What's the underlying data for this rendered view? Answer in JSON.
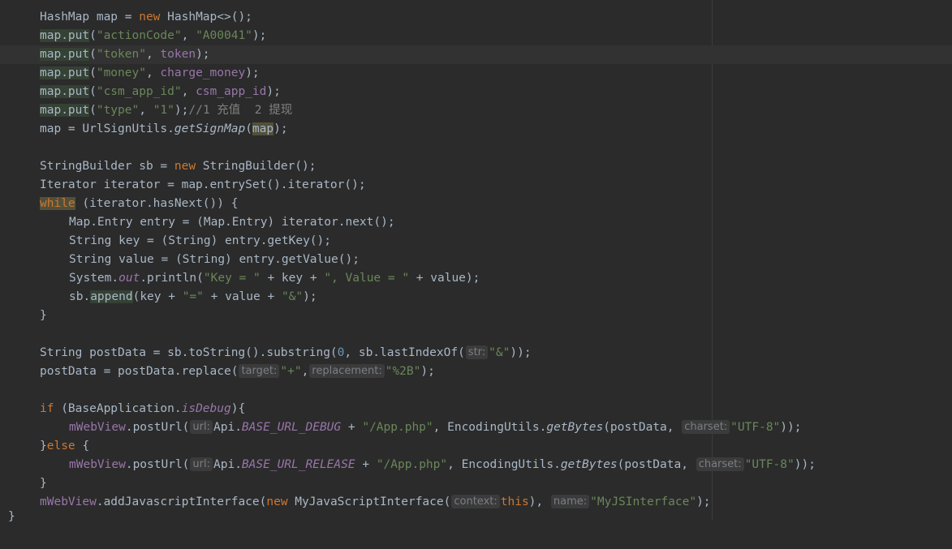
{
  "editor": {
    "lines": {
      "l1": {
        "a": "HashMap map = ",
        "b": "new",
        "c": " HashMap<>();"
      },
      "l2": {
        "a": "map.put",
        "b": "(",
        "c": "\"actionCode\"",
        "d": ", ",
        "e": "\"A00041\"",
        "f": ");"
      },
      "l3": {
        "a": "map.put",
        "b": "(",
        "c": "\"token\"",
        "d": ", ",
        "e": "token",
        "f": ");"
      },
      "l4": {
        "a": "map.put",
        "b": "(",
        "c": "\"money\"",
        "d": ", ",
        "e": "charge_money",
        "f": ");"
      },
      "l5": {
        "a": "map.put",
        "b": "(",
        "c": "\"csm_app_id\"",
        "d": ", ",
        "e": "csm_app_id",
        "f": ");"
      },
      "l6": {
        "a": "map.put",
        "b": "(",
        "c": "\"type\"",
        "d": ", ",
        "e": "\"1\"",
        "f": ");",
        "g": "//1 充值  2 提现"
      },
      "l7": {
        "a": "map = UrlSignUtils.",
        "b": "getSignMap",
        "c": "(",
        "d": "map",
        "e": ");"
      },
      "l9": {
        "a": "StringBuilder sb = ",
        "b": "new",
        "c": " StringBuilder();"
      },
      "l10": {
        "a": "Iterator iterator = map.entrySet().iterator();"
      },
      "l11": {
        "a": "while",
        "b": " (iterator.hasNext()) {"
      },
      "l12": {
        "a": "Map.Entry entry = (Map.Entry) iterator.next();"
      },
      "l13": {
        "a": "String key = (String) entry.getKey();"
      },
      "l14": {
        "a": "String value = (String) entry.getValue();"
      },
      "l15": {
        "a": "System.",
        "b": "out",
        "c": ".println(",
        "d": "\"Key = \"",
        "e": " + key + ",
        "f": "\", Value = \"",
        "g": " + value);"
      },
      "l16": {
        "a": "sb.",
        "b": "append",
        "c": "(key + ",
        "d": "\"=\"",
        "e": " + value + ",
        "f": "\"&\"",
        "g": ");"
      },
      "l17": {
        "a": "}"
      },
      "l19": {
        "a": "String postData = sb.toString().substring(",
        "b": "0",
        "c": ", sb.lastIndexOf(",
        "hint": "str:",
        "d": "\"&\"",
        "e": "));"
      },
      "l20": {
        "a": "postData = postData.replace(",
        "hint1": "target:",
        "b": "\"+\"",
        "c": ",",
        "hint2": "replacement:",
        "d": "\"%2B\"",
        "e": ");"
      },
      "l22": {
        "a": "if",
        "b": " (BaseApplication.",
        "c": "isDebug",
        "d": "){"
      },
      "l23": {
        "a": "mWebView",
        "b": ".postUrl(",
        "hint1": "url:",
        "c": "Api.",
        "d": "BASE_URL_DEBUG",
        "e": " + ",
        "f": "\"/App.php\"",
        "g": ", EncodingUtils.",
        "h": "getBytes",
        "i": "(postData, ",
        "hint2": "charset:",
        "j": "\"UTF-8\"",
        "k": "));"
      },
      "l24": {
        "a": "}",
        "b": "else",
        "c": " {"
      },
      "l25": {
        "a": "mWebView",
        "b": ".postUrl(",
        "hint1": "url:",
        "c": "Api.",
        "d": "BASE_URL_RELEASE",
        "e": " + ",
        "f": "\"/App.php\"",
        "g": ", EncodingUtils.",
        "h": "getBytes",
        "i": "(postData, ",
        "hint2": "charset:",
        "j": "\"UTF-8\"",
        "k": "));"
      },
      "l26": {
        "a": "}"
      },
      "l27": {
        "a": "mWebView",
        "b": ".addJavascriptInterface(",
        "c": "new",
        "d": " MyJavaScriptInterface(",
        "hint1": "context:",
        "e": "this",
        "f": "), ",
        "hint2": "name:",
        "g": "\"MyJSInterface\"",
        "h": ");"
      },
      "l28": {
        "a": "}"
      }
    }
  },
  "colors": {
    "background": "#2b2b2b",
    "text": "#a9b7c6",
    "keyword": "#cc7832",
    "string": "#6a8759",
    "number": "#6897bb",
    "field": "#9876aa",
    "comment": "#808080",
    "current_line": "#323232"
  }
}
